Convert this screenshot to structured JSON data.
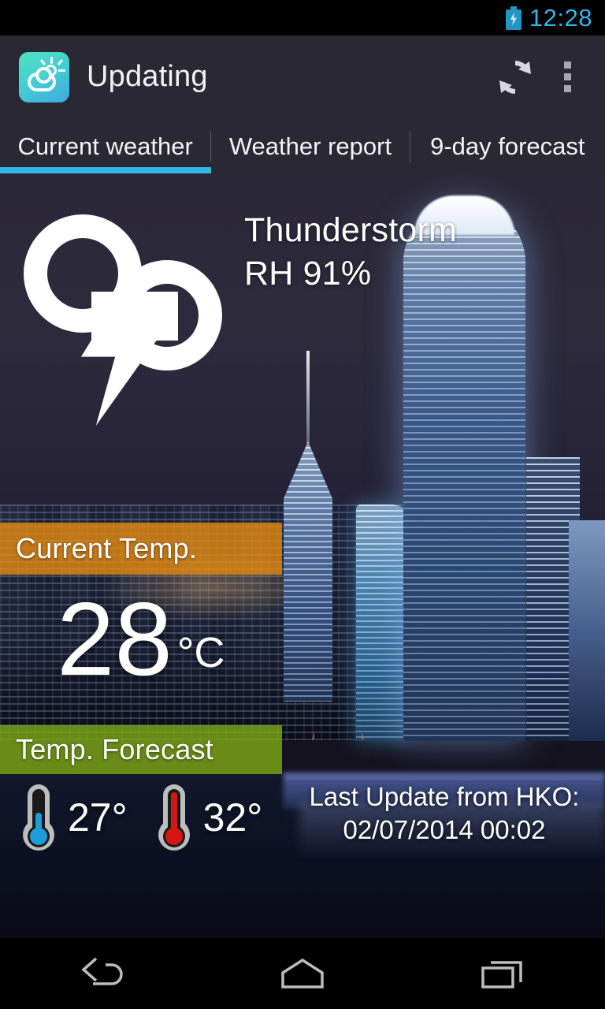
{
  "status_bar": {
    "time": "12:28",
    "battery_icon": "battery-charging-icon",
    "accent_color": "#33b5e5"
  },
  "action_bar": {
    "app_icon": "weather-app-icon",
    "title": "Updating",
    "refresh_icon": "refresh-icon",
    "overflow_icon": "overflow-menu-icon",
    "background_color": "#2a2833"
  },
  "tabs": {
    "items": [
      {
        "label": "Current weather",
        "selected": true
      },
      {
        "label": "Weather report",
        "selected": false
      },
      {
        "label": "9-day forecast",
        "selected": false
      }
    ],
    "indicator_color": "#33b5e5"
  },
  "current_weather": {
    "icon": "thunderstorm-icon",
    "condition": "Thunderstorm",
    "humidity": "RH 91%",
    "current_temp": {
      "label": "Current Temp.",
      "value": "28",
      "unit": "°C",
      "bar_color": "#e28911"
    },
    "temp_forecast": {
      "label": "Temp. Forecast",
      "bar_color": "#7eaa16",
      "low": {
        "icon": "thermometer-low-icon",
        "value": "27°",
        "color": "#1b9dd9"
      },
      "high": {
        "icon": "thermometer-high-icon",
        "value": "32°",
        "color": "#d61515"
      }
    },
    "last_update": {
      "line1": "Last Update from HKO:",
      "line2": "02/07/2014 00:02"
    }
  },
  "nav_bar": {
    "back": "back-icon",
    "home": "home-icon",
    "recents": "recent-apps-icon"
  }
}
